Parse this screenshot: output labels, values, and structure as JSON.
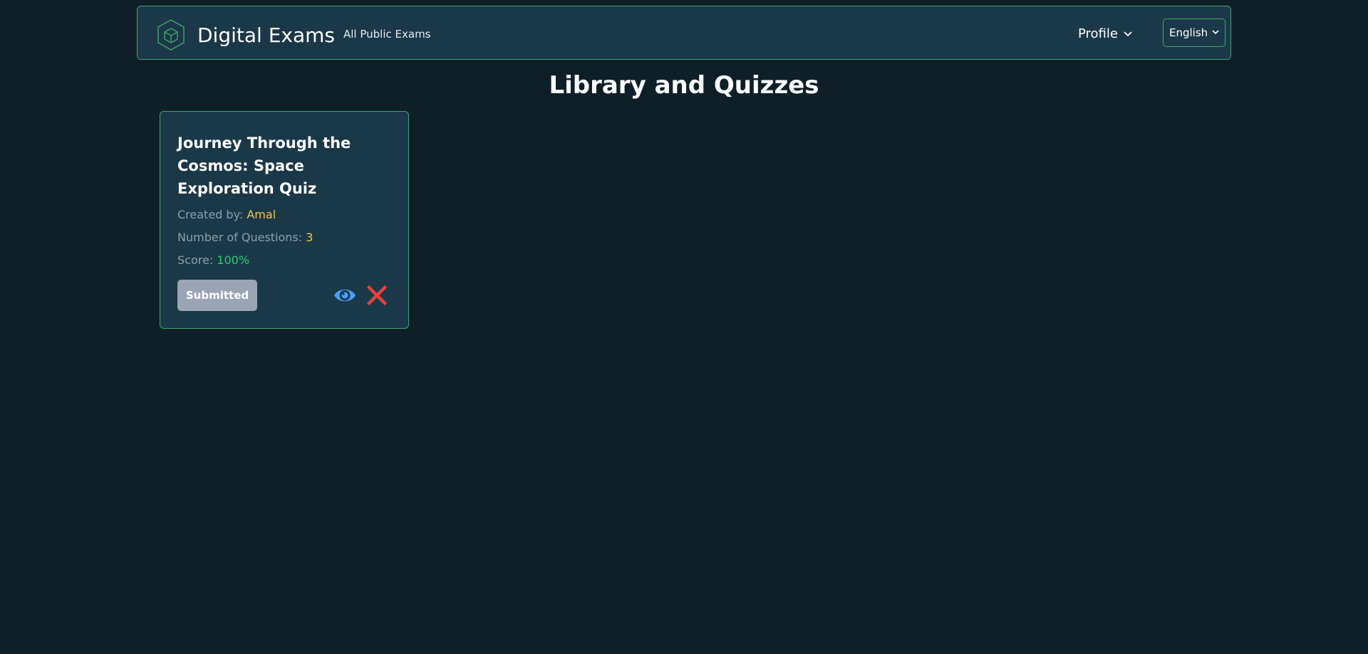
{
  "header": {
    "brand_title": "Digital Exams",
    "nav_link": "All Public Exams",
    "profile_label": "Profile",
    "language": "English"
  },
  "main": {
    "page_title": "Library and Quizzes",
    "quizzes": [
      {
        "title": "Journey Through the Cosmos: Space Exploration Quiz",
        "created_by_label": "Created by:",
        "created_by": "Amal",
        "questions_label": "Number of Questions:",
        "questions": "3",
        "score_label": "Score:",
        "score": "100%",
        "status_button": "Submitted",
        "view_icon": "eye-icon",
        "delete_icon": "close-icon"
      }
    ]
  },
  "colors": {
    "background": "#0f1f28",
    "panel": "#1b3848",
    "border_accent": "#3fa56a",
    "highlight_yellow": "#f0c54a",
    "score_green": "#2ecc71",
    "view_blue": "#4a9ff5",
    "delete_red": "#e8403a",
    "disabled_button": "#9ba4b2"
  }
}
